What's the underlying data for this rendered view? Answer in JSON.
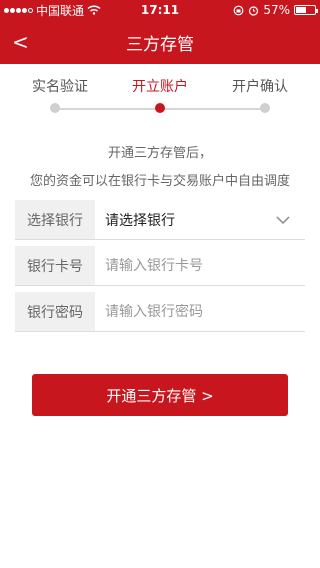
{
  "status_bar": {
    "carrier": "中国联通",
    "time": "17:11",
    "battery_percent": "57%",
    "battery_level": 0.57,
    "signal_bars": 4
  },
  "nav": {
    "back_glyph": "<",
    "title": "三方存管"
  },
  "steps": {
    "items": [
      "实名验证",
      "开立账户",
      "开户确认"
    ],
    "active_index": 1
  },
  "intro": {
    "line1": "开通三方存管后，",
    "line2": "您的资金可以在银行卡与交易账户中自由调度"
  },
  "form": {
    "bank": {
      "label": "选择银行",
      "value": "请选择银行"
    },
    "card": {
      "label": "银行卡号",
      "placeholder": "请输入银行卡号"
    },
    "password": {
      "label": "银行密码",
      "placeholder": "请输入银行密码"
    }
  },
  "submit": {
    "label": "开通三方存管 >"
  },
  "colors": {
    "brand": "#c8161e",
    "label_bg": "#f0f0f0"
  }
}
